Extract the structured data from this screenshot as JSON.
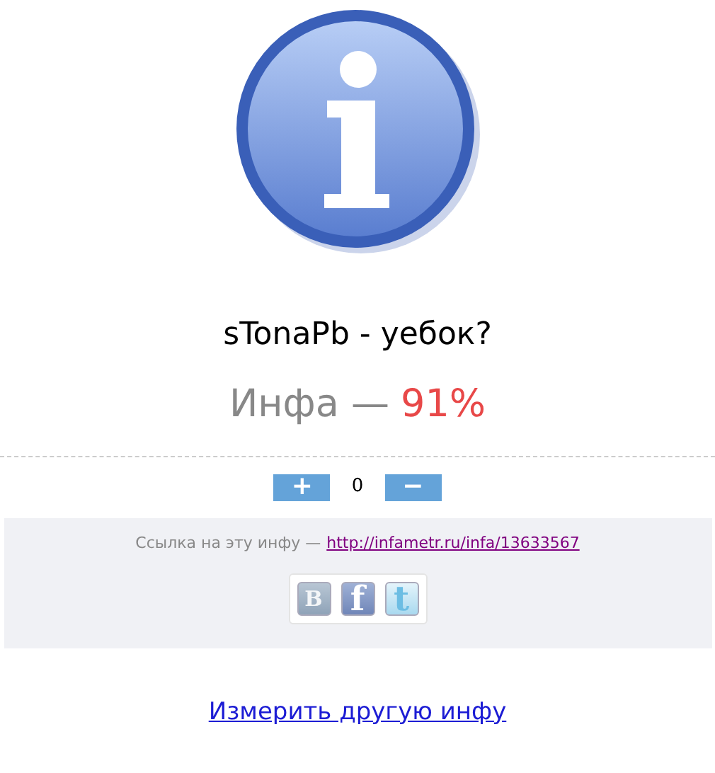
{
  "question": "sTonaPb - уебок?",
  "result": {
    "label": "Инфа —",
    "percent": "91%"
  },
  "vote": {
    "plus": "+",
    "count": "0",
    "minus": "−"
  },
  "share": {
    "text": "Ссылка на эту инфу —",
    "url": "http://infametr.ru/infa/13633567"
  },
  "social": [
    {
      "kind": "vk",
      "label": "B"
    },
    {
      "kind": "facebook",
      "label": "f"
    },
    {
      "kind": "twitter",
      "label": "t"
    }
  ],
  "again_link": "Измерить другую инфу"
}
